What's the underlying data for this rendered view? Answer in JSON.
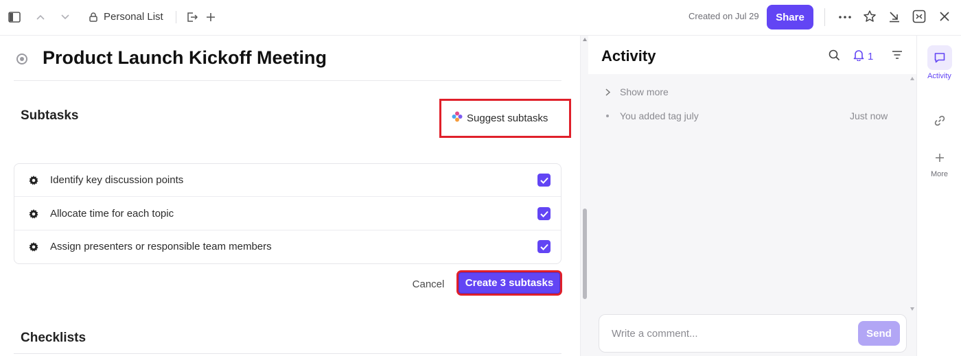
{
  "topbar": {
    "list_name": "Personal List",
    "created_text": "Created on Jul 29",
    "share_label": "Share"
  },
  "task": {
    "title": "Product Launch Kickoff Meeting"
  },
  "subtasks": {
    "heading": "Subtasks",
    "suggest_label": "Suggest subtasks",
    "items": [
      {
        "label": "Identify key discussion points",
        "checked": true
      },
      {
        "label": "Allocate time for each topic",
        "checked": true
      },
      {
        "label": "Assign presenters or responsible team members",
        "checked": true
      }
    ],
    "cancel_label": "Cancel",
    "create_label": "Create 3 subtasks"
  },
  "checklists": {
    "heading": "Checklists"
  },
  "activity": {
    "title": "Activity",
    "notification_count": "1",
    "show_more": "Show more",
    "entries": [
      {
        "text": "You added tag july",
        "time": "Just now"
      }
    ],
    "comment_placeholder": "Write a comment...",
    "send_label": "Send"
  },
  "rail": {
    "activity_label": "Activity",
    "more_label": "More"
  },
  "colors": {
    "accent": "#6245f4",
    "highlight": "#e0202a"
  }
}
